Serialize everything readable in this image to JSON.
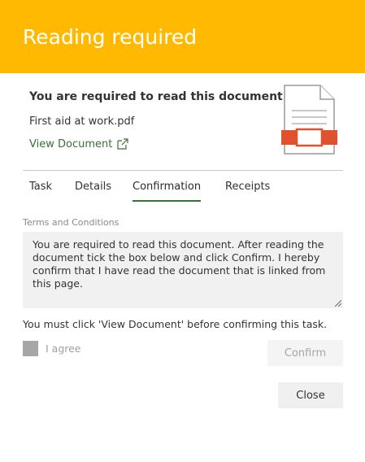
{
  "header": {
    "title": "Reading required",
    "background_color": "#ffb900"
  },
  "document": {
    "heading": "You are required to read this document",
    "filename": "First aid at work.pdf",
    "view_link": "View Document",
    "link_icon": "external-link-icon",
    "file_icon": "pdf-document-icon"
  },
  "tabs": [
    {
      "label": "Task",
      "active": false
    },
    {
      "label": "Details",
      "active": false
    },
    {
      "label": "Confirmation",
      "active": true
    },
    {
      "label": "Receipts",
      "active": false
    }
  ],
  "confirmation": {
    "terms_label": "Terms and Conditions",
    "terms_text": "You are required to read this document. After reading the document tick the box below and click Confirm. I hereby confirm that I have read the document that is linked from this page.",
    "warning": "You must click 'View Document' before confirming this task.",
    "agree_label": "I agree",
    "agree_checked": false,
    "confirm_label": "Confirm",
    "confirm_enabled": false
  },
  "footer": {
    "close_label": "Close"
  },
  "colors": {
    "accent": "#3a6e3a",
    "file_icon_red": "#e0522e"
  }
}
